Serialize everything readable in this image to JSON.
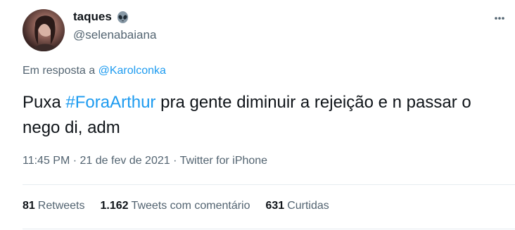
{
  "author": {
    "display_name": "taques",
    "emoji_icon": "alien-icon",
    "handle": "@selenabaiana",
    "avatar_icon": "avatar-photo"
  },
  "reply": {
    "prefix": "Em resposta a",
    "mention": "@Karolconka"
  },
  "tweet": {
    "text_before": "Puxa",
    "hashtag": "#ForaArthur",
    "text_after": "pra gente diminuir a rejeição e n passar o nego di, adm"
  },
  "meta": {
    "time": "11:45 PM",
    "separator": "·",
    "date": "21 de fev de 2021",
    "source": "Twitter for iPhone"
  },
  "stats": {
    "retweets_count": "81",
    "retweets_label": "Retweets",
    "quotes_count": "1.162",
    "quotes_label": "Tweets com comentário",
    "likes_count": "631",
    "likes_label": "Curtidas"
  },
  "colors": {
    "accent": "#1d9bf0",
    "secondary_text": "#536471",
    "primary_text": "#0f1419"
  }
}
